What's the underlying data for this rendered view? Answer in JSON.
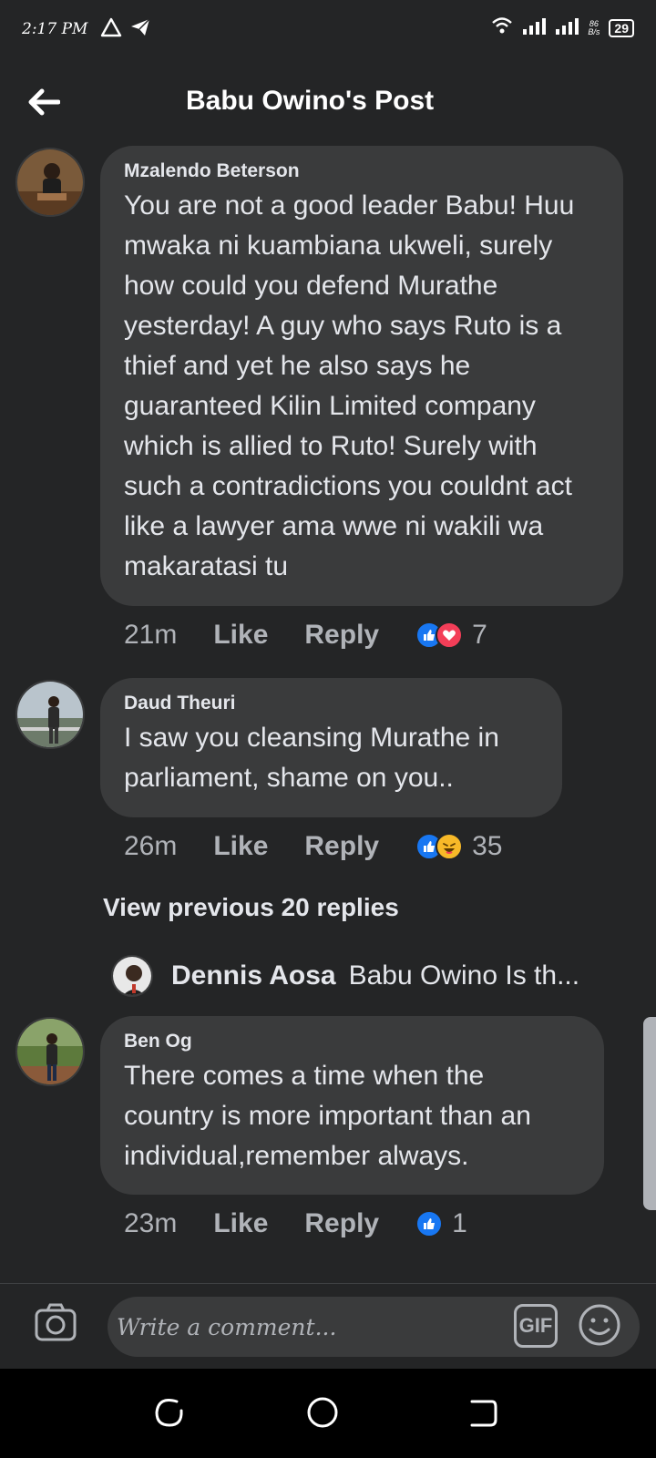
{
  "status_bar": {
    "time": "2:17 PM",
    "net_speed_top": "86",
    "net_speed_bottom": "B/s",
    "battery": "29"
  },
  "header": {
    "title": "Babu Owino's Post"
  },
  "comments": [
    {
      "author": "Mzalendo Beterson",
      "text": "You are not a good leader Babu! Huu mwaka ni kuambiana ukweli, surely how could you defend Murathe yesterday! A guy who says Ruto is a thief and yet he also says he guaranteed Kilin Limited company which is allied to Ruto! Surely with such a contradictions you couldnt act like a lawyer ama wwe ni wakili wa makaratasi tu",
      "time": "21m",
      "like_label": "Like",
      "reply_label": "Reply",
      "reactions": [
        "like-icon",
        "love-icon"
      ],
      "reaction_count": "7"
    },
    {
      "author": "Daud Theuri",
      "text": "I saw you cleansing Murathe in parliament, shame on you..",
      "time": "26m",
      "like_label": "Like",
      "reply_label": "Reply",
      "reactions": [
        "like-icon",
        "haha-icon"
      ],
      "reaction_count": "35"
    },
    {
      "author": "Ben Og",
      "text": "There comes a time when the country is more important than an individual,remember always.",
      "time": "23m",
      "like_label": "Like",
      "reply_label": "Reply",
      "reactions": [
        "like-icon"
      ],
      "reaction_count": "1"
    }
  ],
  "view_previous": "View previous 20 replies",
  "reply_preview": {
    "name": "Dennis Aosa",
    "text": "Babu Owino Is th..."
  },
  "composer": {
    "placeholder": "Write a comment...",
    "gif_label": "GIF"
  },
  "colors": {
    "background": "#242526",
    "bubble": "#3a3b3c",
    "like_blue": "#1877f2",
    "love_red": "#f33e58",
    "haha_yellow": "#f7b928"
  }
}
